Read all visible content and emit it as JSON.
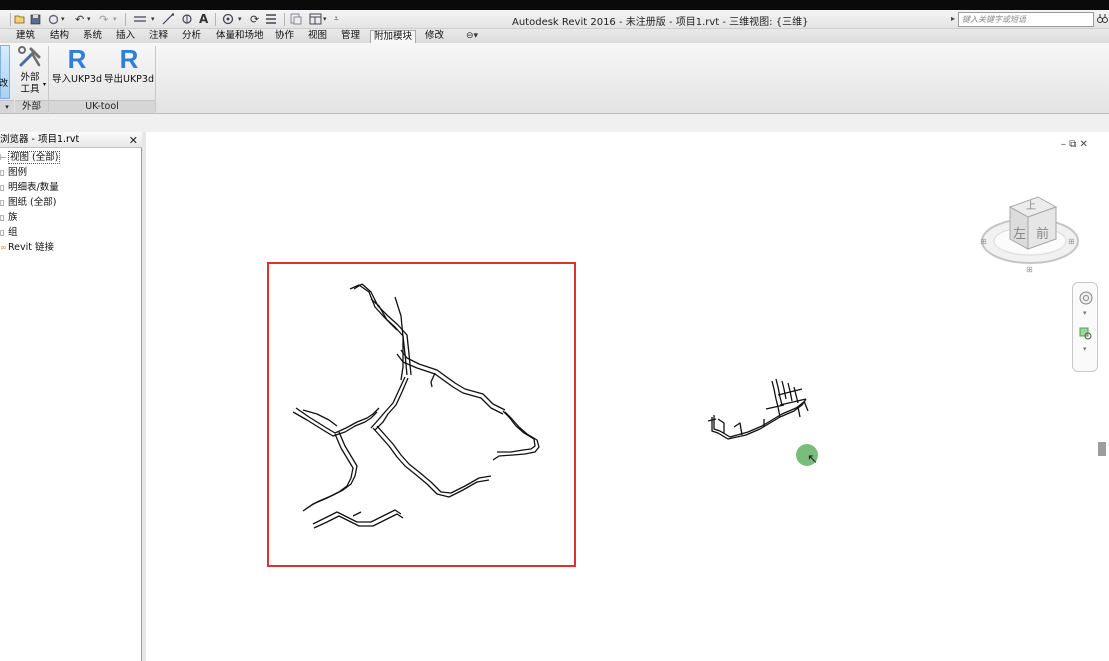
{
  "app": {
    "title": "Autodesk Revit 2016 - 未注册版 -     项目1.rvt - 三维视图: {三维}",
    "search_placeholder": "键入关键字或短语"
  },
  "qat_icons": [
    "open-icon",
    "save-icon",
    "sync-icon",
    "undo-icon",
    "redo-icon",
    "measure-icon",
    "dimension-icon",
    "tag-icon",
    "text-icon",
    "3d-view-icon",
    "section-icon",
    "thin-lines-icon",
    "close-hidden-icon",
    "switch-windows-icon",
    "customize-icon"
  ],
  "ribbon": {
    "tabs": [
      "建筑",
      "结构",
      "系统",
      "插入",
      "注释",
      "分析",
      "体量和场地",
      "协作",
      "视图",
      "管理",
      "附加模块",
      "修改"
    ],
    "active_tab": "附加模块",
    "left_partial_label": "改",
    "external_tools_label": "外部\n工具",
    "external_tools_label_1": "外部",
    "external_tools_label_2": "工具",
    "import_label": "导入UKP3d",
    "export_label": "导出UKP3d",
    "panel_external": "外部",
    "panel_uktool": "UK-tool"
  },
  "browser": {
    "title": "浏览器 - 项目1.rvt",
    "items": [
      {
        "label": "视图 (全部)"
      },
      {
        "label": "图例"
      },
      {
        "label": "明细表/数量"
      },
      {
        "label": "图纸 (全部)"
      },
      {
        "label": "族"
      },
      {
        "label": "组"
      },
      {
        "label": "Revit 链接"
      }
    ]
  },
  "viewcube": {
    "top_label": "上",
    "left_label": "左",
    "front_label": "前"
  },
  "colors": {
    "highlight": "#e03131",
    "active_tab_bg": "#f7f7f7",
    "cursor_dot": "#6bb56b"
  }
}
